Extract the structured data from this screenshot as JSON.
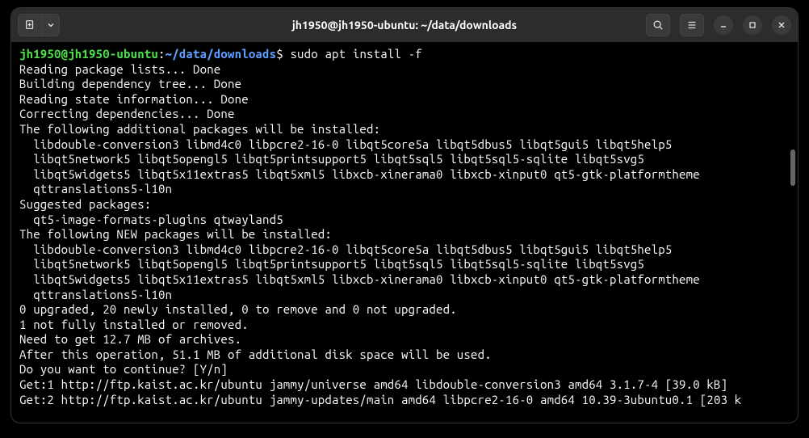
{
  "title": "jh1950@jh1950-ubuntu: ~/data/downloads",
  "prompt": {
    "user": "jh1950@jh1950-ubuntu",
    "path": "~/data/downloads",
    "command": "sudo apt install -f"
  },
  "lines": [
    "Reading package lists... Done",
    "Building dependency tree... Done",
    "Reading state information... Done",
    "Correcting dependencies... Done",
    "The following additional packages will be installed:",
    "  libdouble-conversion3 libmd4c0 libpcre2-16-0 libqt5core5a libqt5dbus5 libqt5gui5 libqt5help5",
    "  libqt5network5 libqt5opengl5 libqt5printsupport5 libqt5sql5 libqt5sql5-sqlite libqt5svg5",
    "  libqt5widgets5 libqt5x11extras5 libqt5xml5 libxcb-xinerama0 libxcb-xinput0 qt5-gtk-platformtheme",
    "  qttranslations5-l10n",
    "Suggested packages:",
    "  qt5-image-formats-plugins qtwayland5",
    "The following NEW packages will be installed:",
    "  libdouble-conversion3 libmd4c0 libpcre2-16-0 libqt5core5a libqt5dbus5 libqt5gui5 libqt5help5",
    "  libqt5network5 libqt5opengl5 libqt5printsupport5 libqt5sql5 libqt5sql5-sqlite libqt5svg5",
    "  libqt5widgets5 libqt5x11extras5 libqt5xml5 libxcb-xinerama0 libxcb-xinput0 qt5-gtk-platformtheme",
    "  qttranslations5-l10n",
    "0 upgraded, 20 newly installed, 0 to remove and 0 not upgraded.",
    "1 not fully installed or removed.",
    "Need to get 12.7 MB of archives.",
    "After this operation, 51.1 MB of additional disk space will be used.",
    "Do you want to continue? [Y/n]",
    "Get:1 http://ftp.kaist.ac.kr/ubuntu jammy/universe amd64 libdouble-conversion3 amd64 3.1.7-4 [39.0 kB]",
    "Get:2 http://ftp.kaist.ac.kr/ubuntu jammy-updates/main amd64 libpcre2-16-0 amd64 10.39-3ubuntu0.1 [203 k"
  ]
}
